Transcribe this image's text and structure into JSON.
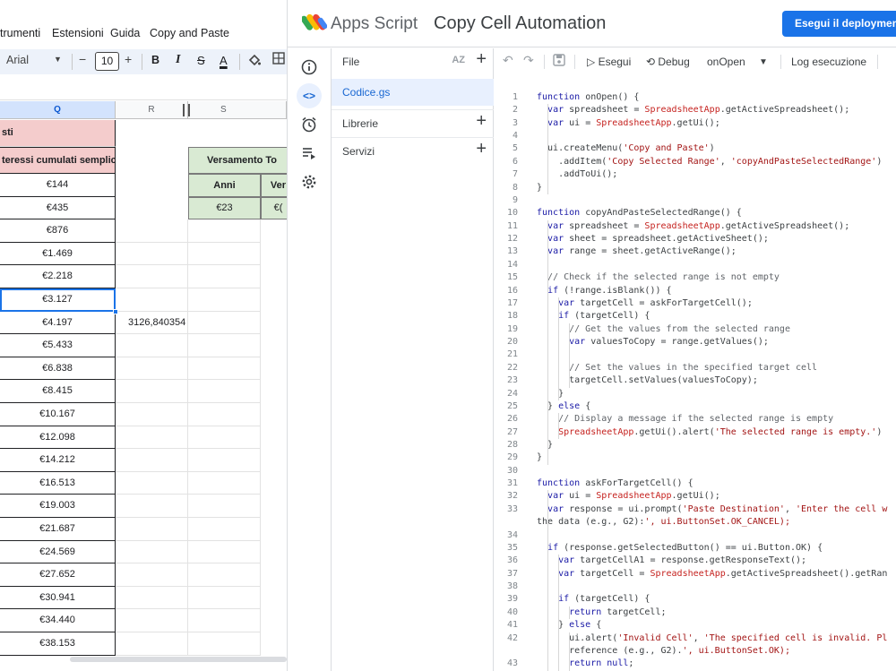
{
  "sheets": {
    "menu": [
      "trumenti",
      "Estensioni",
      "Guida",
      "Copy and Paste"
    ],
    "toolbar": {
      "font": "Arial",
      "font_size": "10",
      "minus": "−",
      "plus": "+",
      "bold": "B",
      "italic": "I",
      "strike": "S",
      "text_color": "A",
      "fill_icon": "fill-color-icon",
      "borders_icon": "borders-icon"
    },
    "columns": [
      "Q",
      "R",
      "S"
    ],
    "selected_column": "Q",
    "header_pink_1": "sti",
    "header_pink_2": "teressi cumulati semplici",
    "green_header": "Versamento To",
    "green_sub": [
      "Anni",
      "Ver"
    ],
    "green_values": [
      "€23",
      "€("
    ],
    "q_values": [
      "€144",
      "€435",
      "€876",
      "€1.469",
      "€2.218",
      "€3.127",
      "€4.197",
      "€5.433",
      "€6.838",
      "€8.415",
      "€10.167",
      "€12.098",
      "€14.212",
      "€16.513",
      "€19.003",
      "€21.687",
      "€24.569",
      "€27.652",
      "€30.941",
      "€34.440",
      "€38.153"
    ],
    "selected_cell_value": "€3.127",
    "r_value": "3126,840354"
  },
  "apps_script": {
    "brand": "Apps Script",
    "project_title": "Copy Cell Automation",
    "deploy_button": "Esegui il deployment",
    "rail_icons": [
      "info-icon",
      "code-icon",
      "triggers-clock-icon",
      "executions-icon",
      "settings-gear-icon"
    ],
    "files_panel": {
      "title": "File",
      "sort_label": "AZ",
      "active_file": "Codice.gs",
      "libraries": "Librerie",
      "services": "Servizi"
    },
    "toolbar": {
      "run": "Esegui",
      "debug": "Debug",
      "function": "onOpen",
      "log": "Log esecuzione"
    },
    "code_lines": [
      "function onOpen() {",
      "  var spreadsheet = SpreadsheetApp.getActiveSpreadsheet();",
      "  var ui = SpreadsheetApp.getUi();",
      "",
      "  ui.createMenu('Copy and Paste')",
      "    .addItem('Copy Selected Range', 'copyAndPasteSelectedRange')",
      "    .addToUi();",
      "}",
      "",
      "function copyAndPasteSelectedRange() {",
      "  var spreadsheet = SpreadsheetApp.getActiveSpreadsheet();",
      "  var sheet = spreadsheet.getActiveSheet();",
      "  var range = sheet.getActiveRange();",
      "",
      "  // Check if the selected range is not empty",
      "  if (!range.isBlank()) {",
      "    var targetCell = askForTargetCell();",
      "    if (targetCell) {",
      "      // Get the values from the selected range",
      "      var valuesToCopy = range.getValues();",
      "",
      "      // Set the values in the specified target cell",
      "      targetCell.setValues(valuesToCopy);",
      "    }",
      "  } else {",
      "    // Display a message if the selected range is empty",
      "    SpreadsheetApp.getUi().alert('The selected range is empty.')",
      "  }",
      "}",
      "",
      "function askForTargetCell() {",
      "  var ui = SpreadsheetApp.getUi();",
      "  var response = ui.prompt('Paste Destination', 'Enter the cell w",
      "the data (e.g., G2):', ui.ButtonSet.OK_CANCEL);",
      "",
      "  if (response.getSelectedButton() == ui.Button.OK) {",
      "    var targetCellA1 = response.getResponseText();",
      "    var targetCell = SpreadsheetApp.getActiveSpreadsheet().getRan",
      "",
      "    if (targetCell) {",
      "      return targetCell;",
      "    } else {",
      "      ui.alert('Invalid Cell', 'The specified cell is invalid. Pl",
      "      reference (e.g., G2).', ui.ButtonSet.OK);",
      "      return null;"
    ],
    "line_numbers": [
      "1",
      "2",
      "3",
      "4",
      "5",
      "6",
      "7",
      "8",
      "9",
      "10",
      "11",
      "12",
      "13",
      "14",
      "15",
      "16",
      "17",
      "18",
      "19",
      "20",
      "21",
      "22",
      "23",
      "24",
      "25",
      "26",
      "27",
      "28",
      "29",
      "30",
      "31",
      "32",
      "33",
      "",
      "34",
      "35",
      "36",
      "37",
      "38",
      "39",
      "40",
      "41",
      "42",
      "",
      "43"
    ],
    "colors": {
      "accent": "#1a73e8",
      "keyword": "#1a1aa6",
      "string": "#a31515",
      "comment": "#5f6368",
      "app_ref": "#c5221f"
    }
  }
}
